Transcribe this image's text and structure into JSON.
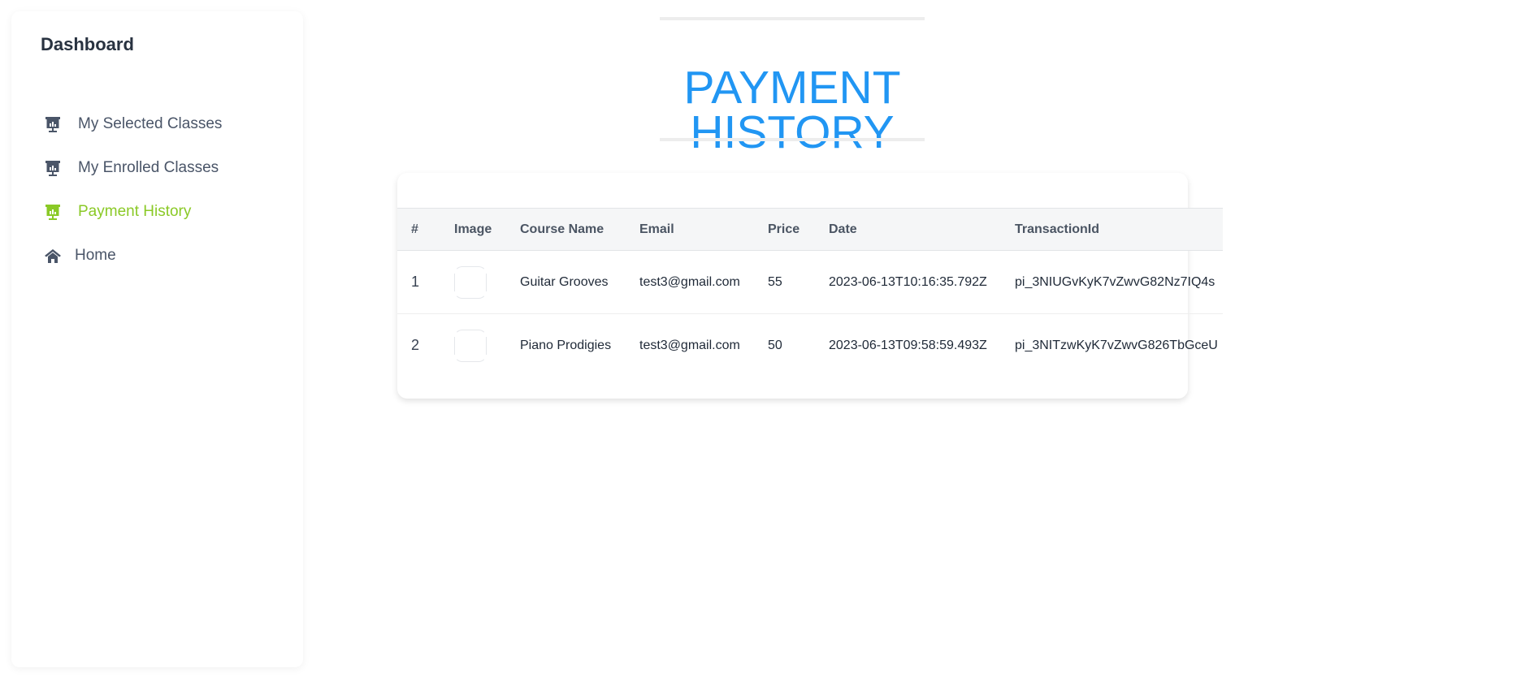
{
  "sidebar": {
    "title": "Dashboard",
    "items": [
      {
        "label": "My Selected Classes",
        "icon": "presentation-chart-icon",
        "active": false
      },
      {
        "label": "My Enrolled Classes",
        "icon": "presentation-chart-icon",
        "active": false
      },
      {
        "label": "Payment History",
        "icon": "presentation-chart-icon",
        "active": true
      },
      {
        "label": "Home",
        "icon": "home-icon",
        "active": false
      }
    ]
  },
  "main": {
    "title_line1": "PAYMENT",
    "title_line2": "HISTORY"
  },
  "table": {
    "headers": [
      "#",
      "Image",
      "Course Name",
      "Email",
      "Price",
      "Date",
      "TransactionId"
    ],
    "rows": [
      {
        "num": "1",
        "course": "Guitar Grooves",
        "email": "test3@gmail.com",
        "price": "55",
        "date": "2023-06-13T10:16:35.792Z",
        "transaction": "pi_3NIUGvKyK7vZwvG82Nz7IQ4s"
      },
      {
        "num": "2",
        "course": "Piano Prodigies",
        "email": "test3@gmail.com",
        "price": "50",
        "date": "2023-06-13T09:58:59.493Z",
        "transaction": "pi_3NITzwKyK7vZwvG826TbGceU"
      }
    ]
  },
  "colors": {
    "accent": "#2196f3",
    "active_nav": "#8ac926",
    "nav_text": "#4a5568"
  }
}
